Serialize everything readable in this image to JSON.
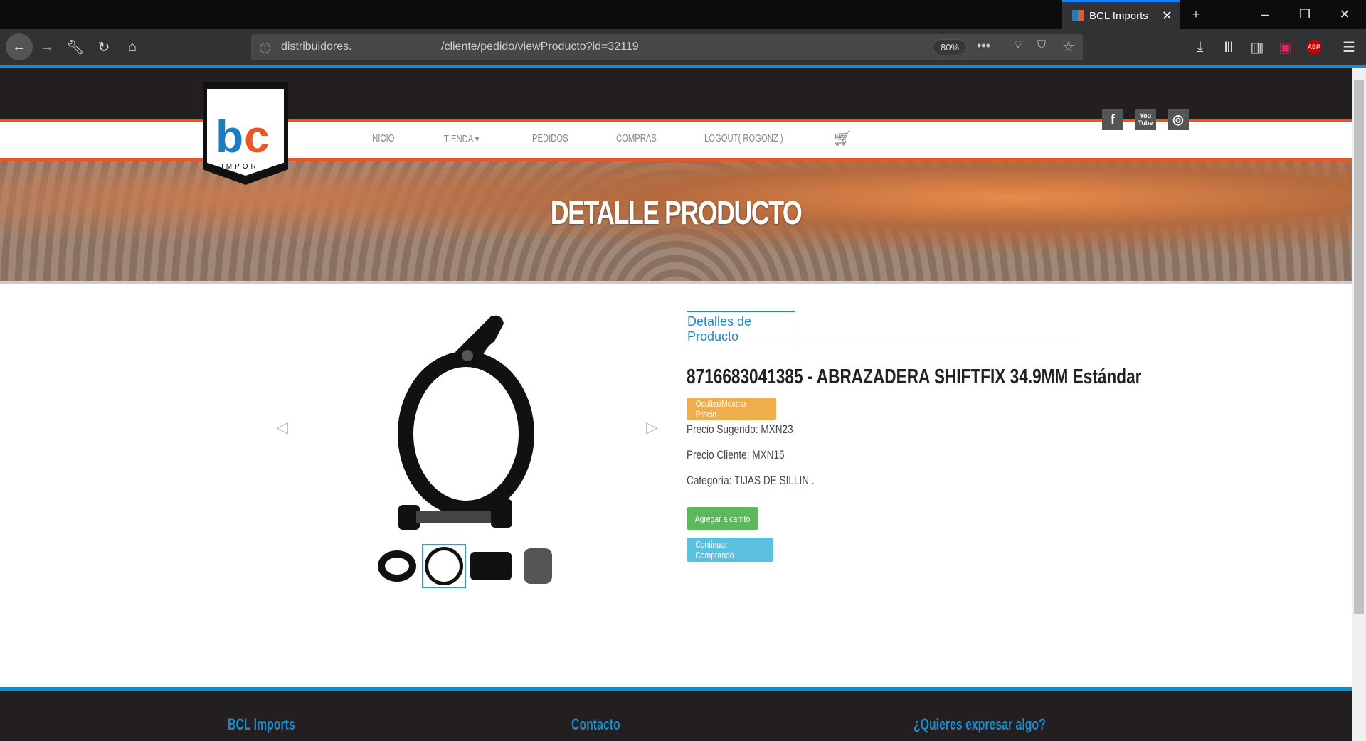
{
  "browser": {
    "tab_title": "BCL Imports",
    "url_domain": "distribuidores.",
    "url_path": "/cliente/pedido/viewProducto?id=32119",
    "zoom": "80%"
  },
  "site": {
    "logo_text": "IMPOR",
    "nav": [
      "INICIO",
      "TIENDA",
      "PEDIDOS",
      "COMPRAS",
      "LOGOUT( ROGONZ )"
    ],
    "hero_title": "DETALLE PRODUCTO",
    "social": [
      "f",
      "You Tube",
      "◎"
    ]
  },
  "product": {
    "tab": "Detalles de Producto",
    "title": "8716683041385 - ABRAZADERA SHIFTFIX 34.9MM Estándar",
    "toggle_price": "Ocultar/Mostrar Precio",
    "suggested_price": "Precio Sugerido: MXN23",
    "client_price": "Precio Cliente: MXN15",
    "category": "Categoría: TIJAS DE SILLIN .",
    "add_to_cart": "Agregar a carrito",
    "continue": "Continuar Comprando",
    "thumbnail_count": 4,
    "selected_thumbnail": 2
  },
  "footer": {
    "col1": "BCL Imports",
    "col2": "Contacto",
    "col3": "¿Quieres expresar algo?"
  }
}
